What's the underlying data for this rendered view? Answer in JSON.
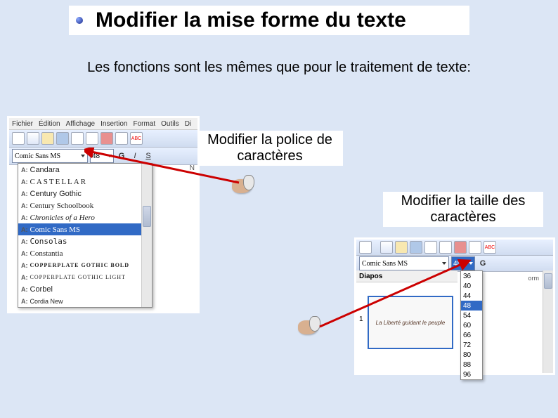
{
  "title": "Modifier la mise forme du texte",
  "subtitle": "Les fonctions sont les mêmes que pour le traitement de texte:",
  "caption_font": "Modifier la police de caractères",
  "caption_size": "Modifier la taille des caractères",
  "menubar": {
    "file": "Fichier",
    "edit": "Édition",
    "view": "Affichage",
    "insert": "Insertion",
    "format": "Format",
    "tools": "Outils",
    "di": "Di"
  },
  "font_combo_value": "Comic Sans MS",
  "size_combo_value_left": "48",
  "size_combo_value_right": "48",
  "format_buttons": {
    "bold": "G",
    "italic": "I",
    "underline": "S"
  },
  "font_list": [
    {
      "label": "Candara",
      "family": "Candara, sans-serif"
    },
    {
      "label": "CASTELLAR",
      "family": "serif",
      "spacing": "2px"
    },
    {
      "label": "Century Gothic",
      "family": "'Century Gothic', sans-serif"
    },
    {
      "label": "Century Schoolbook",
      "family": "'Century Schoolbook', serif"
    },
    {
      "label": "Chronicles of a Hero",
      "family": "cursive",
      "style": "italic"
    },
    {
      "label": "Comic Sans MS",
      "family": "'Comic Sans MS', cursive",
      "selected": true
    },
    {
      "label": "Consolas",
      "family": "Consolas, monospace"
    },
    {
      "label": "Constantia",
      "family": "Constantia, serif"
    },
    {
      "label": "COPPERPLATE GOTHIC BOLD",
      "family": "serif",
      "weight": "bold",
      "spacing": "1px",
      "size": "8px"
    },
    {
      "label": "COPPERPLATE GOTHIC LIGHT",
      "family": "serif",
      "spacing": "1px",
      "size": "8px"
    },
    {
      "label": "Corbel",
      "family": "Corbel, sans-serif"
    },
    {
      "label": "Cordia New",
      "family": "sans-serif",
      "size": "9px"
    }
  ],
  "size_list": [
    "36",
    "40",
    "44",
    "48",
    "54",
    "60",
    "66",
    "72",
    "80",
    "88",
    "96"
  ],
  "size_selected": "48",
  "diapos_label": "Diapos",
  "slide_number": "1",
  "slide_title": "La Liberté guidant le peuple",
  "fmt_last": "G",
  "colors": {
    "selection": "#316ac5",
    "page_bg": "#dce6f5",
    "arrow": "#cc0000"
  }
}
